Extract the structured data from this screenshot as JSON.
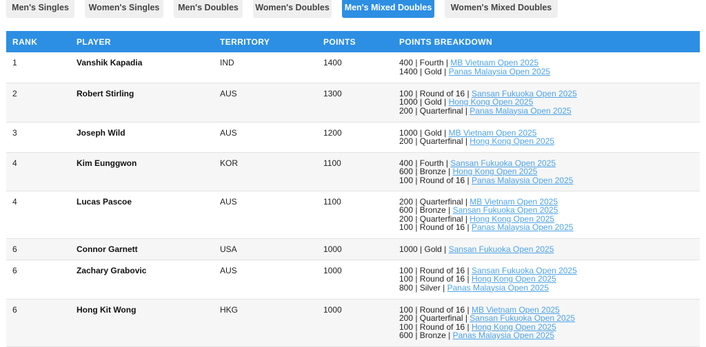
{
  "tabs": [
    {
      "label": "Men's Singles",
      "active": false
    },
    {
      "label": "Women's Singles",
      "active": false
    },
    {
      "label": "Men's Doubles",
      "active": false
    },
    {
      "label": "Women's Doubles",
      "active": false
    },
    {
      "label": "Men's Mixed Doubles",
      "active": true
    },
    {
      "label": "Women's Mixed Doubles",
      "active": false
    }
  ],
  "table": {
    "headers": {
      "rank": "RANK",
      "player": "PLAYER",
      "territory": "TERRITORY",
      "points": "POINTS",
      "breakdown": "POINTS BREAKDOWN"
    },
    "rows": [
      {
        "rank": "1",
        "player": "Vanshik Kapadia",
        "territory": "IND",
        "points": "1400",
        "breakdown": [
          {
            "prefix": "400 | Fourth |",
            "event": "MB Vietnam Open 2025"
          },
          {
            "prefix": "1400 | Gold |",
            "event": "Panas Malaysia Open 2025"
          }
        ]
      },
      {
        "rank": "2",
        "player": "Robert Stirling",
        "territory": "AUS",
        "points": "1300",
        "breakdown": [
          {
            "prefix": "100 | Round of 16 |",
            "event": "Sansan Fukuoka Open 2025"
          },
          {
            "prefix": "1000 | Gold |",
            "event": "Hong Kong Open 2025"
          },
          {
            "prefix": "200 | Quarterfinal |",
            "event": "Panas Malaysia Open 2025"
          }
        ]
      },
      {
        "rank": "3",
        "player": "Joseph Wild",
        "territory": "AUS",
        "points": "1200",
        "breakdown": [
          {
            "prefix": "1000 | Gold |",
            "event": "MB Vietnam Open 2025"
          },
          {
            "prefix": "200 | Quarterfinal |",
            "event": "Hong Kong Open 2025"
          }
        ]
      },
      {
        "rank": "4",
        "player": "Kim Eunggwon",
        "territory": "KOR",
        "points": "1100",
        "breakdown": [
          {
            "prefix": "400 | Fourth |",
            "event": "Sansan Fukuoka Open 2025"
          },
          {
            "prefix": "600 | Bronze |",
            "event": "Hong Kong Open 2025"
          },
          {
            "prefix": "100 | Round of 16 |",
            "event": "Panas Malaysia Open 2025"
          }
        ]
      },
      {
        "rank": "4",
        "player": "Lucas Pascoe",
        "territory": "AUS",
        "points": "1100",
        "breakdown": [
          {
            "prefix": "200 | Quarterfinal |",
            "event": "MB Vietnam Open 2025"
          },
          {
            "prefix": "600 | Bronze |",
            "event": "Sansan Fukuoka Open 2025"
          },
          {
            "prefix": "200 | Quarterfinal |",
            "event": "Hong Kong Open 2025"
          },
          {
            "prefix": "100 | Round of 16 |",
            "event": "Panas Malaysia Open 2025"
          }
        ]
      },
      {
        "rank": "6",
        "player": "Connor Garnett",
        "territory": "USA",
        "points": "1000",
        "breakdown": [
          {
            "prefix": "1000 | Gold |",
            "event": "Sansan Fukuoka Open 2025"
          }
        ]
      },
      {
        "rank": "6",
        "player": "Zachary Grabovic",
        "territory": "AUS",
        "points": "1000",
        "breakdown": [
          {
            "prefix": "100 | Round of 16 |",
            "event": "Sansan Fukuoka Open 2025"
          },
          {
            "prefix": "100 | Round of 16 |",
            "event": "Hong Kong Open 2025"
          },
          {
            "prefix": "800 | Silver |",
            "event": "Panas Malaysia Open 2025"
          }
        ]
      },
      {
        "rank": "6",
        "player": "Hong Kit Wong",
        "territory": "HKG",
        "points": "1000",
        "breakdown": [
          {
            "prefix": "100 | Round of 16 |",
            "event": "MB Vietnam Open 2025"
          },
          {
            "prefix": "200 | Quarterfinal |",
            "event": "Sansan Fukuoka Open 2025"
          },
          {
            "prefix": "100 | Round of 16 |",
            "event": "Hong Kong Open 2025"
          },
          {
            "prefix": "600 | Bronze |",
            "event": "Panas Malaysia Open 2025"
          }
        ]
      }
    ]
  }
}
